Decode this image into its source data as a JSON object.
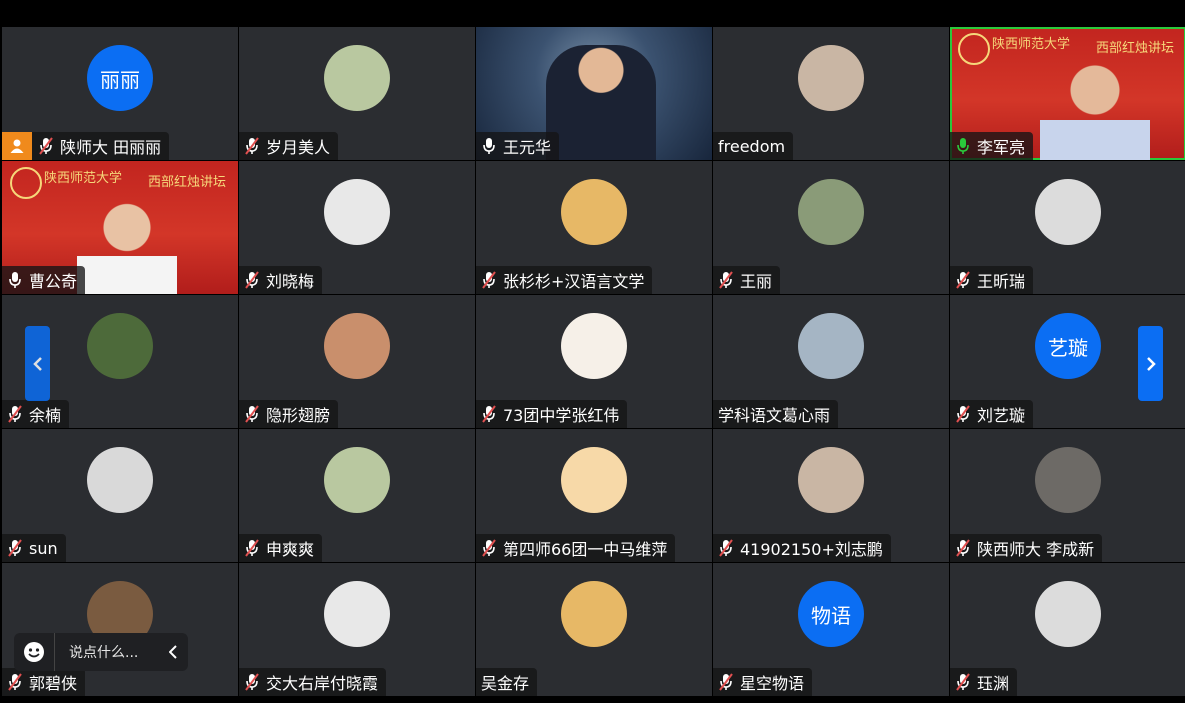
{
  "participants": [
    {
      "name": "陕师大 田丽丽",
      "avatar_text": "丽丽",
      "avatar_kind": "text",
      "mic": "muted",
      "badge": "person-icon"
    },
    {
      "name": "岁月美人",
      "avatar_kind": "photo",
      "mic": "muted"
    },
    {
      "name": "王元华",
      "avatar_kind": "video-space",
      "mic": "on"
    },
    {
      "name": "freedom",
      "avatar_kind": "photo",
      "mic": "none"
    },
    {
      "name": "李军亮",
      "avatar_kind": "video-red",
      "mic": "active"
    },
    {
      "name": "曹公奇",
      "avatar_kind": "video-red2",
      "mic": "on"
    },
    {
      "name": "刘晓梅",
      "avatar_kind": "photo",
      "mic": "muted"
    },
    {
      "name": "张杉杉+汉语言文学",
      "avatar_kind": "photo",
      "mic": "muted"
    },
    {
      "name": "王丽",
      "avatar_kind": "photo",
      "mic": "muted"
    },
    {
      "name": "王昕瑞",
      "avatar_kind": "photo",
      "mic": "muted"
    },
    {
      "name": "余楠",
      "avatar_kind": "photo",
      "mic": "muted"
    },
    {
      "name": "隐形翅膀",
      "avatar_kind": "photo",
      "mic": "muted"
    },
    {
      "name": "73团中学张红伟",
      "avatar_kind": "photo",
      "mic": "muted"
    },
    {
      "name": "学科语文葛心雨",
      "avatar_kind": "photo",
      "mic": "none"
    },
    {
      "name": "刘艺璇",
      "avatar_text": "艺璇",
      "avatar_kind": "text",
      "mic": "muted"
    },
    {
      "name": "sun",
      "avatar_kind": "photo",
      "mic": "muted"
    },
    {
      "name": "申爽爽",
      "avatar_kind": "photo",
      "mic": "muted"
    },
    {
      "name": "第四师66团一中马维萍",
      "avatar_kind": "photo",
      "mic": "muted"
    },
    {
      "name": "41902150+刘志鹏",
      "avatar_kind": "photo",
      "mic": "muted"
    },
    {
      "name": "陕西师大 李成新",
      "avatar_kind": "photo",
      "mic": "muted"
    },
    {
      "name": "郭碧侠",
      "avatar_kind": "photo",
      "mic": "muted"
    },
    {
      "name": "交大右岸付晓霞",
      "avatar_kind": "photo",
      "mic": "muted"
    },
    {
      "name": "吴金存",
      "avatar_kind": "photo",
      "mic": "none"
    },
    {
      "name": "星空物语",
      "avatar_text": "物语",
      "avatar_kind": "text",
      "mic": "muted"
    },
    {
      "name": "珏渊",
      "avatar_kind": "photo",
      "mic": "muted"
    }
  ],
  "video_red_title_left": "陕西师范大学",
  "video_red_title_right": "西部红烛讲坛",
  "chat": {
    "placeholder": "说点什么..."
  },
  "colors": {
    "accent": "#0b6ef3",
    "muted_mic": "#e05050",
    "active_mic": "#2ac93b"
  },
  "nav": {
    "prev": "chevron-left-icon",
    "next": "chevron-right-icon"
  }
}
